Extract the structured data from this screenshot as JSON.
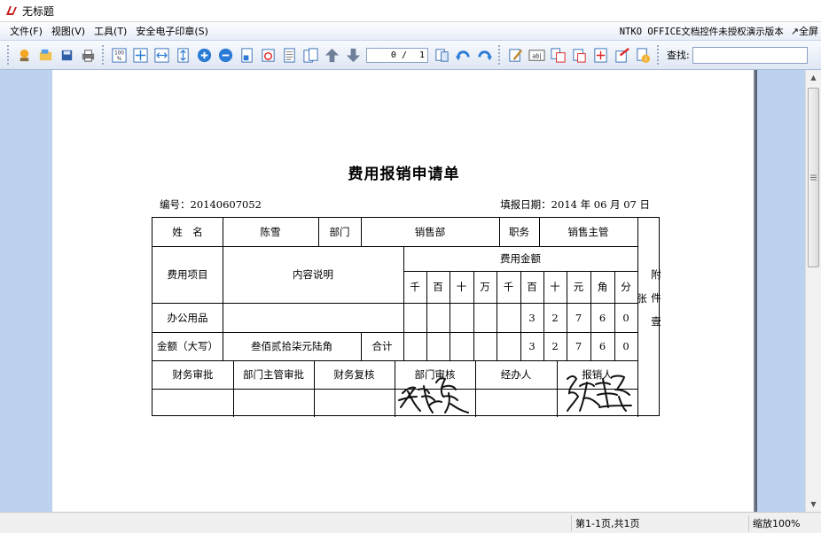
{
  "window": {
    "title": "无标题"
  },
  "menu": {
    "items": [
      "文件(F)",
      "视图(V)",
      "工具(T)",
      "安全电子印章(S)"
    ],
    "notice": "NTKO OFFICE文档控件未授权演示版本",
    "fullscreen": "↗全屏"
  },
  "toolbar": {
    "page_current": "0 /",
    "page_total": "1",
    "find_label": "查找:",
    "find_value": ""
  },
  "document": {
    "title": "费用报销申请单",
    "number": "编号：20140607052",
    "date": "填报日期：2014 年 06 月 07 日",
    "form": {
      "name_label": "姓　名",
      "name_value": "陈雪",
      "dept_label": "部门",
      "dept_value": "销售部",
      "position_label": "职务",
      "position_value": "销售主管",
      "attach_label": "附件壹张",
      "item_header": "费用项目",
      "content_header": "内容说明",
      "amount_header": "费用金额",
      "digit_headers": [
        "千",
        "百",
        "十",
        "万",
        "千",
        "百",
        "十",
        "元",
        "角",
        "分"
      ],
      "row1_label": "办公用品",
      "row1_digits": [
        "",
        "",
        "",
        "",
        "",
        "3",
        "2",
        "7",
        "6",
        "0"
      ],
      "total_label": "金额（大写）",
      "total_words": "叁佰贰拾柒元陆角",
      "sum_label": "合计",
      "total_digits": [
        "",
        "",
        "",
        "",
        "",
        "3",
        "2",
        "7",
        "6",
        "0"
      ],
      "approvals": [
        "财务审批",
        "部门主管审批",
        "财务复核",
        "部门审核",
        "经办人",
        "报销人"
      ]
    }
  },
  "status": {
    "page_info": "第1-1页,共1页",
    "zoom": "缩放100%"
  }
}
